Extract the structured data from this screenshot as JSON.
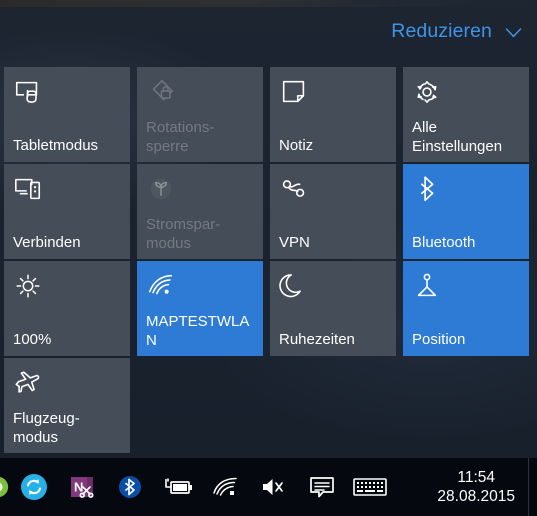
{
  "theme": {
    "panel_background": "#1b2330",
    "tile_inactive": "#454d58",
    "tile_active_accent": "#2d7bd4",
    "accent_link": "#3f93e8",
    "taskbar_background": "#06080f",
    "text_primary": "#ffffff",
    "text_disabled": "#737a84"
  },
  "action_center": {
    "collapse": {
      "label": "Reduzieren",
      "icon": "chevron-down-icon"
    },
    "tiles": [
      {
        "id": "tablet-mode",
        "label": "Tabletmodus",
        "icon": "tablet-mode-icon",
        "state": "inactive",
        "lines": 1
      },
      {
        "id": "rotation-lock",
        "label": "Rotations-\nsperre",
        "label_line1": "Rotations-",
        "label_line2": "sperre",
        "icon": "rotation-lock-icon",
        "state": "disabled",
        "lines": 2
      },
      {
        "id": "note",
        "label": "Notiz",
        "icon": "note-icon",
        "state": "inactive",
        "lines": 1
      },
      {
        "id": "all-settings",
        "label": "Alle\nEinstellungen",
        "label_line1": "Alle",
        "label_line2": "Einstellungen",
        "icon": "gear-icon",
        "state": "inactive",
        "lines": 2
      },
      {
        "id": "connect",
        "label": "Verbinden",
        "icon": "connect-icon",
        "state": "inactive",
        "lines": 1
      },
      {
        "id": "battery-saver",
        "label": "Stromspar-\nmodus",
        "label_line1": "Stromspar-",
        "label_line2": "modus",
        "icon": "battery-saver-leaf-icon",
        "state": "disabled",
        "lines": 2
      },
      {
        "id": "vpn",
        "label": "VPN",
        "icon": "vpn-icon",
        "state": "inactive",
        "lines": 1
      },
      {
        "id": "bluetooth",
        "label": "Bluetooth",
        "icon": "bluetooth-icon",
        "state": "active",
        "lines": 1
      },
      {
        "id": "brightness",
        "label": "100%",
        "icon": "brightness-sun-icon",
        "state": "inactive",
        "lines": 1
      },
      {
        "id": "wifi",
        "label": "MAPTESTWLAN",
        "icon": "wifi-icon",
        "state": "active",
        "lines": 2
      },
      {
        "id": "quiet-hours",
        "label": "Ruhezeiten",
        "icon": "moon-icon",
        "state": "inactive",
        "lines": 1
      },
      {
        "id": "location",
        "label": "Position",
        "icon": "location-icon",
        "state": "active",
        "lines": 1
      },
      {
        "id": "airplane-mode",
        "label": "Flugzeug-\nmodus",
        "label_line1": "Flugzeug-",
        "label_line2": "modus",
        "icon": "airplane-icon",
        "state": "inactive",
        "lines": 2
      }
    ]
  },
  "taskbar": {
    "tray_icons": [
      {
        "id": "tray-overflow",
        "name": "tray-overflow-icon",
        "tooltip": ""
      },
      {
        "id": "green-app",
        "name": "green-status-icon",
        "tooltip": ""
      },
      {
        "id": "sync",
        "name": "sync-refresh-icon",
        "tooltip": ""
      },
      {
        "id": "onenote-clipper",
        "name": "onenote-clipper-icon",
        "tooltip": ""
      },
      {
        "id": "bluetooth-tray",
        "name": "bluetooth-tray-icon",
        "tooltip": ""
      },
      {
        "id": "battery-tray",
        "name": "battery-charging-icon",
        "tooltip": ""
      },
      {
        "id": "wifi-tray",
        "name": "wifi-tray-icon",
        "tooltip": ""
      },
      {
        "id": "volume-tray",
        "name": "speaker-muted-icon",
        "tooltip": ""
      },
      {
        "id": "action-center-tray",
        "name": "action-center-icon",
        "tooltip": ""
      },
      {
        "id": "keyboard-tray",
        "name": "touch-keyboard-icon",
        "tooltip": ""
      }
    ],
    "clock": {
      "time": "11:54",
      "date": "28.08.2015"
    },
    "show_desktop": {
      "label": ""
    }
  }
}
